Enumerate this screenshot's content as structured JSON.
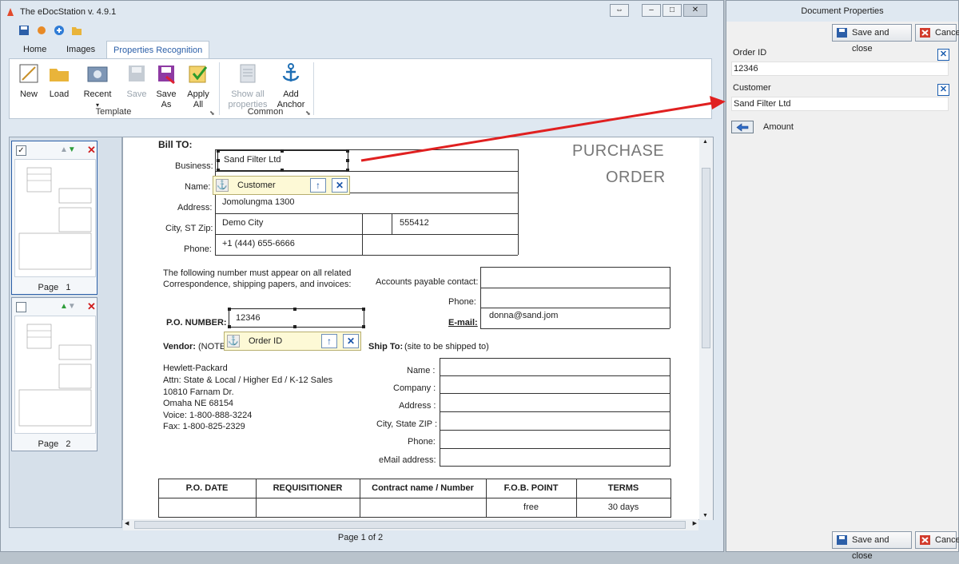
{
  "window": {
    "title": "The eDocStation v. 4.9.1"
  },
  "ribbon": {
    "tabs": [
      "Home",
      "Images",
      "Properties Recognition"
    ],
    "buttons": {
      "new": "New",
      "load": "Load",
      "recent": "Recent",
      "save": "Save",
      "save_as_1": "Save",
      "save_as_2": "As",
      "apply_all_1": "Apply",
      "apply_all_2": "All",
      "show_all_1": "Show all",
      "show_all_2": "properties",
      "add_anchor_1": "Add",
      "add_anchor_2": "Anchor"
    },
    "groups": {
      "template": "Template",
      "common": "Common"
    }
  },
  "thumbnails": [
    {
      "label": "Page",
      "number": "1",
      "checked": true
    },
    {
      "label": "Page",
      "number": "2",
      "checked": false
    }
  ],
  "document": {
    "bill_to": "Bill TO:",
    "title_1": "PURCHASE",
    "title_2": "ORDER",
    "labels": {
      "business": "Business:",
      "name": "Name:",
      "address": "Address:",
      "city": "City, ST Zip:",
      "phone": "Phone:"
    },
    "values": {
      "business": "Sand Filter Ltd",
      "address": "Jomolungma 1300",
      "city": "Demo City",
      "zip": "555412",
      "phone": "+1 (444) 655-6666",
      "po_number": "12346",
      "email": "donna@sand.jom"
    },
    "notice_1": "The following number must appear on all related",
    "notice_2": "Correspondence, shipping papers, and invoices:",
    "ap_contact": "Accounts payable contact:",
    "ap_phone": "Phone:",
    "ap_email": "E-mail:",
    "po_number_label": "P.O. NUMBER:",
    "vendor_label": "Vendor:",
    "vendor_note": "(NOTE",
    "ship_to_label": "Ship To:",
    "ship_to_note": "(site to be shipped to)",
    "vendor_lines": [
      "Hewlett-Packard",
      "Attn: State & Local / Higher Ed / K-12 Sales",
      "10810 Farnam Dr.",
      "Omaha NE 68154",
      "Voice: 1-800-888-3224",
      "Fax: 1-800-825-2329"
    ],
    "ship_labels": [
      "Name :",
      "Company :",
      "Address :",
      "City, State ZIP :",
      "Phone:",
      "eMail address:"
    ],
    "table_headers": [
      "P.O. DATE",
      "REQUISITIONER",
      "Contract name / Number",
      "F.O.B. POINT",
      "TERMS"
    ],
    "table_row": [
      "",
      "",
      "",
      "free",
      "30 days"
    ]
  },
  "anchors": {
    "customer": "Customer",
    "order_id": "Order ID"
  },
  "status": {
    "page": "Page 1 of 2"
  },
  "properties_panel": {
    "title": "Document Properties",
    "save_close": "Save and close",
    "cancel": "Cancel",
    "fields": [
      {
        "label": "Order ID",
        "value": "12346"
      },
      {
        "label": "Customer",
        "value": "Sand Filter Ltd"
      }
    ],
    "amount_label": "Amount"
  },
  "colors": {
    "accent": "#2b5fa8",
    "arrow": "#e02020",
    "close_red": "#d01c1c"
  }
}
